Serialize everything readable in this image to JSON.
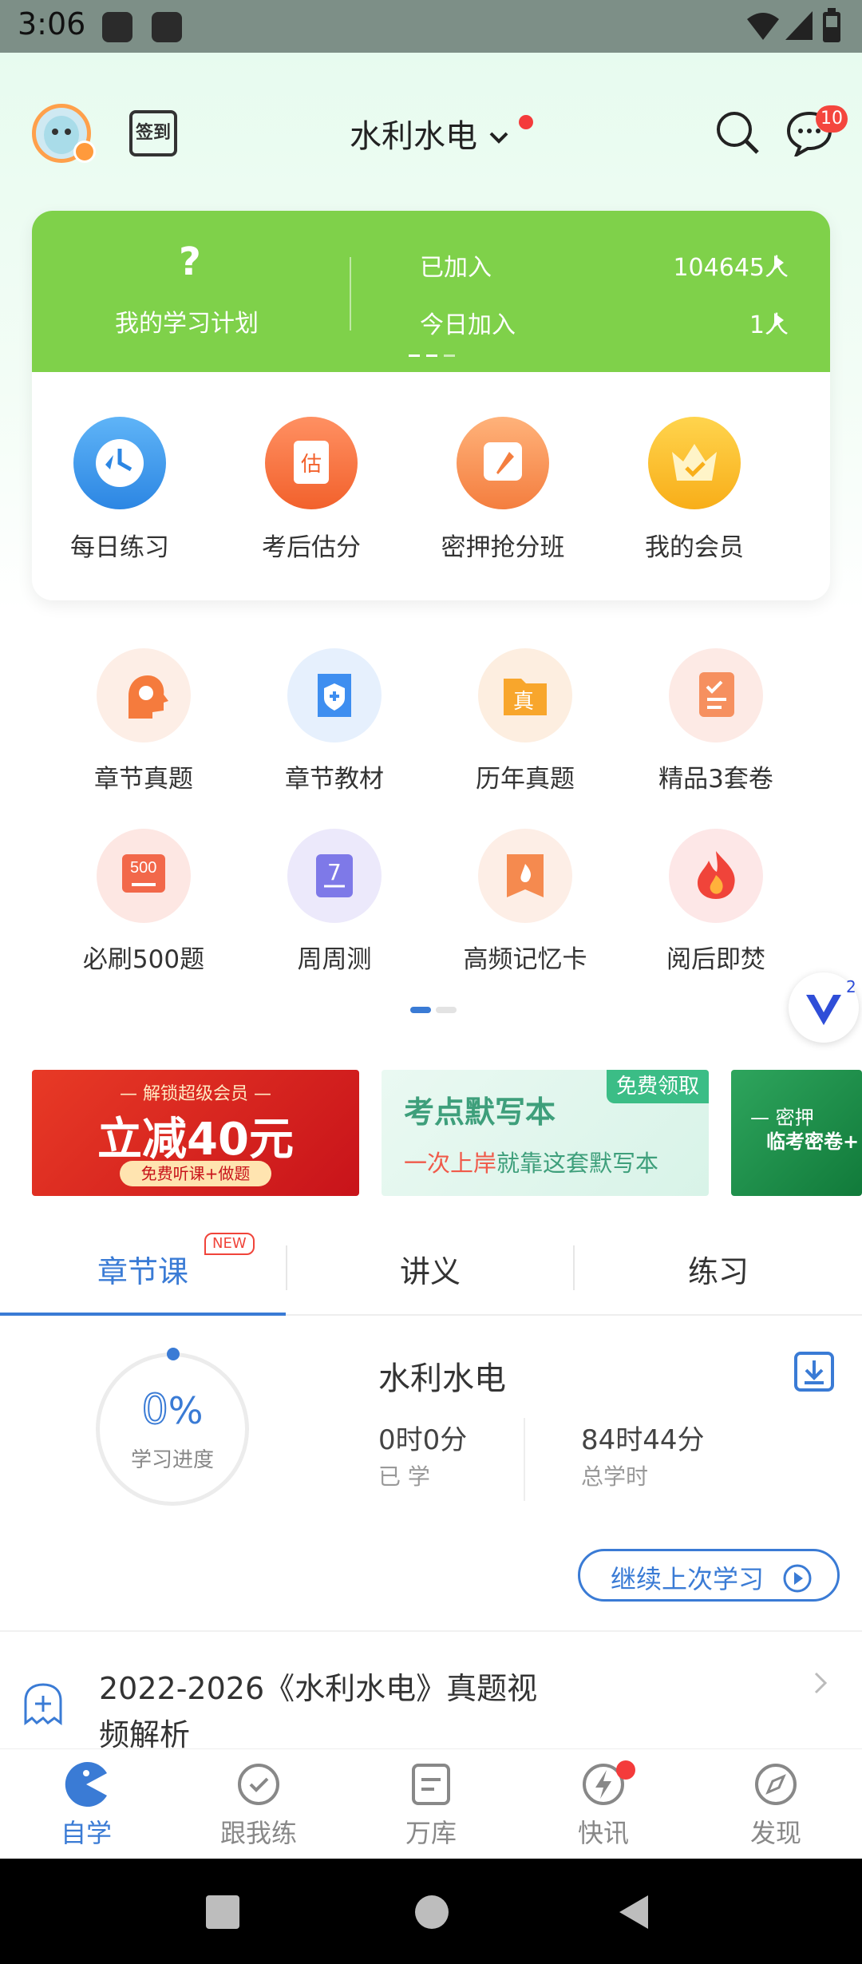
{
  "status_bar": {
    "time": "3:06"
  },
  "header": {
    "signin_label": "签到",
    "subject": "水利水电",
    "message_badge": "10"
  },
  "plan": {
    "question_mark": "?",
    "title": "我的学习计划",
    "joined_label": "已加入",
    "joined_count": "104645人",
    "today_label": "今日加入",
    "today_count": "1人"
  },
  "features": [
    {
      "label": "每日练习",
      "icon": "clock-icon"
    },
    {
      "label": "考后估分",
      "icon": "estimate-icon"
    },
    {
      "label": "密押抢分班",
      "icon": "rocket-icon"
    },
    {
      "label": "我的会员",
      "icon": "crown-icon"
    }
  ],
  "grid": [
    {
      "label": "章节真题",
      "icon": "gear-head-icon",
      "text": ""
    },
    {
      "label": "章节教材",
      "icon": "shield-book-icon",
      "text": ""
    },
    {
      "label": "历年真题",
      "icon": "folder-icon",
      "text": "真"
    },
    {
      "label": "精品3套卷",
      "icon": "clipboard-icon",
      "text": ""
    },
    {
      "label": "必刷500题",
      "icon": "500-icon",
      "text": "500"
    },
    {
      "label": "周周测",
      "icon": "calendar-7-icon",
      "text": "7"
    },
    {
      "label": "高频记忆卡",
      "icon": "fire-card-icon",
      "text": ""
    },
    {
      "label": "阅后即焚",
      "icon": "flame-icon",
      "text": ""
    }
  ],
  "float_badge": "2",
  "banners": {
    "b1_top": "— 解锁超级会员 —",
    "b1_main": "立减40元",
    "b1_sub": "免费听课+做题",
    "b2_title": "考点默写本",
    "b2_tag": "免费领取",
    "b2_sub_a": "一次上岸",
    "b2_sub_b": "就靠这套默写本",
    "b3_line1": "— 密押",
    "b3_line2": "临考密卷+"
  },
  "tabs": {
    "items": [
      "章节课",
      "讲义",
      "练习"
    ],
    "new_badge": "NEW"
  },
  "course": {
    "progress_value": "0",
    "progress_unit": "%",
    "progress_label": "学习进度",
    "title": "水利水电",
    "learned_value": "0时0分",
    "learned_label": "已 学",
    "total_value": "84时44分",
    "total_label": "总学时",
    "continue_label": "继续上次学习"
  },
  "course_item": {
    "title_line1": "2022-2026《水利水电》真题视",
    "title_line2": "频解析"
  },
  "bottom_nav": [
    {
      "label": "自学",
      "icon": "pacman-icon"
    },
    {
      "label": "跟我练",
      "icon": "check-circle-icon"
    },
    {
      "label": "万库",
      "icon": "document-icon"
    },
    {
      "label": "快讯",
      "icon": "lightning-icon"
    },
    {
      "label": "发现",
      "icon": "compass-icon"
    }
  ],
  "colors": {
    "accent": "#3a7bd5",
    "green": "#7fd14a",
    "red": "#e8302a"
  }
}
